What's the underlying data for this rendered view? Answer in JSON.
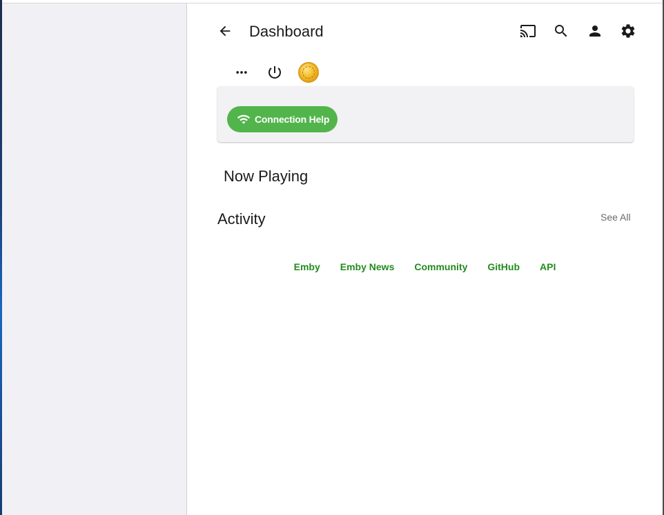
{
  "header": {
    "title": "Dashboard",
    "icons": [
      "arrow-back-icon",
      "cast-icon",
      "search-icon",
      "person-icon",
      "settings-icon"
    ]
  },
  "toolbar": {
    "icons": [
      "more-horiz-icon",
      "power-icon",
      "premiere-badge-icon"
    ]
  },
  "card": {
    "connection_help_label": "Connection Help",
    "accent": "#52b54b"
  },
  "sections": {
    "now_playing": "Now Playing",
    "activity": "Activity",
    "see_all": "See All"
  },
  "footer": {
    "links": [
      "Emby",
      "Emby News",
      "Community",
      "GitHub",
      "API"
    ],
    "link_color": "#238b1f"
  }
}
